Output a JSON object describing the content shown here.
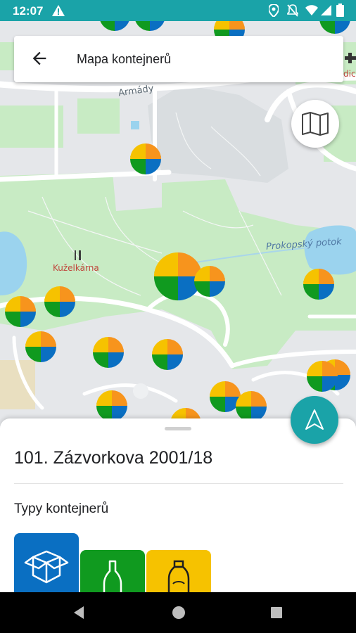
{
  "status_bar": {
    "time": "12:07"
  },
  "toolbar": {
    "title": "Mapa kontejnerů"
  },
  "map": {
    "labels": {
      "street": "Armády",
      "restaurant": "Kuželkárna",
      "stream": "Prokopský potok",
      "edge_fragment": "dic"
    }
  },
  "sheet": {
    "place_name": "101. Zázvorkova 2001/18",
    "types_title": "Typy kontejnerů"
  },
  "container_types": [
    {
      "name": "paper",
      "color": "#0a6fc2",
      "icon": "box-icon"
    },
    {
      "name": "glass",
      "color": "#109a1f",
      "icon": "bottle-icon"
    },
    {
      "name": "plastic",
      "color": "#f6c200",
      "icon": "plastic-bottle-icon"
    }
  ],
  "colors": {
    "accent": "#1aa3a8",
    "paper": "#0a6fc2",
    "glass": "#109a1f",
    "plastic": "#f6c200",
    "other": "#f7941d"
  }
}
